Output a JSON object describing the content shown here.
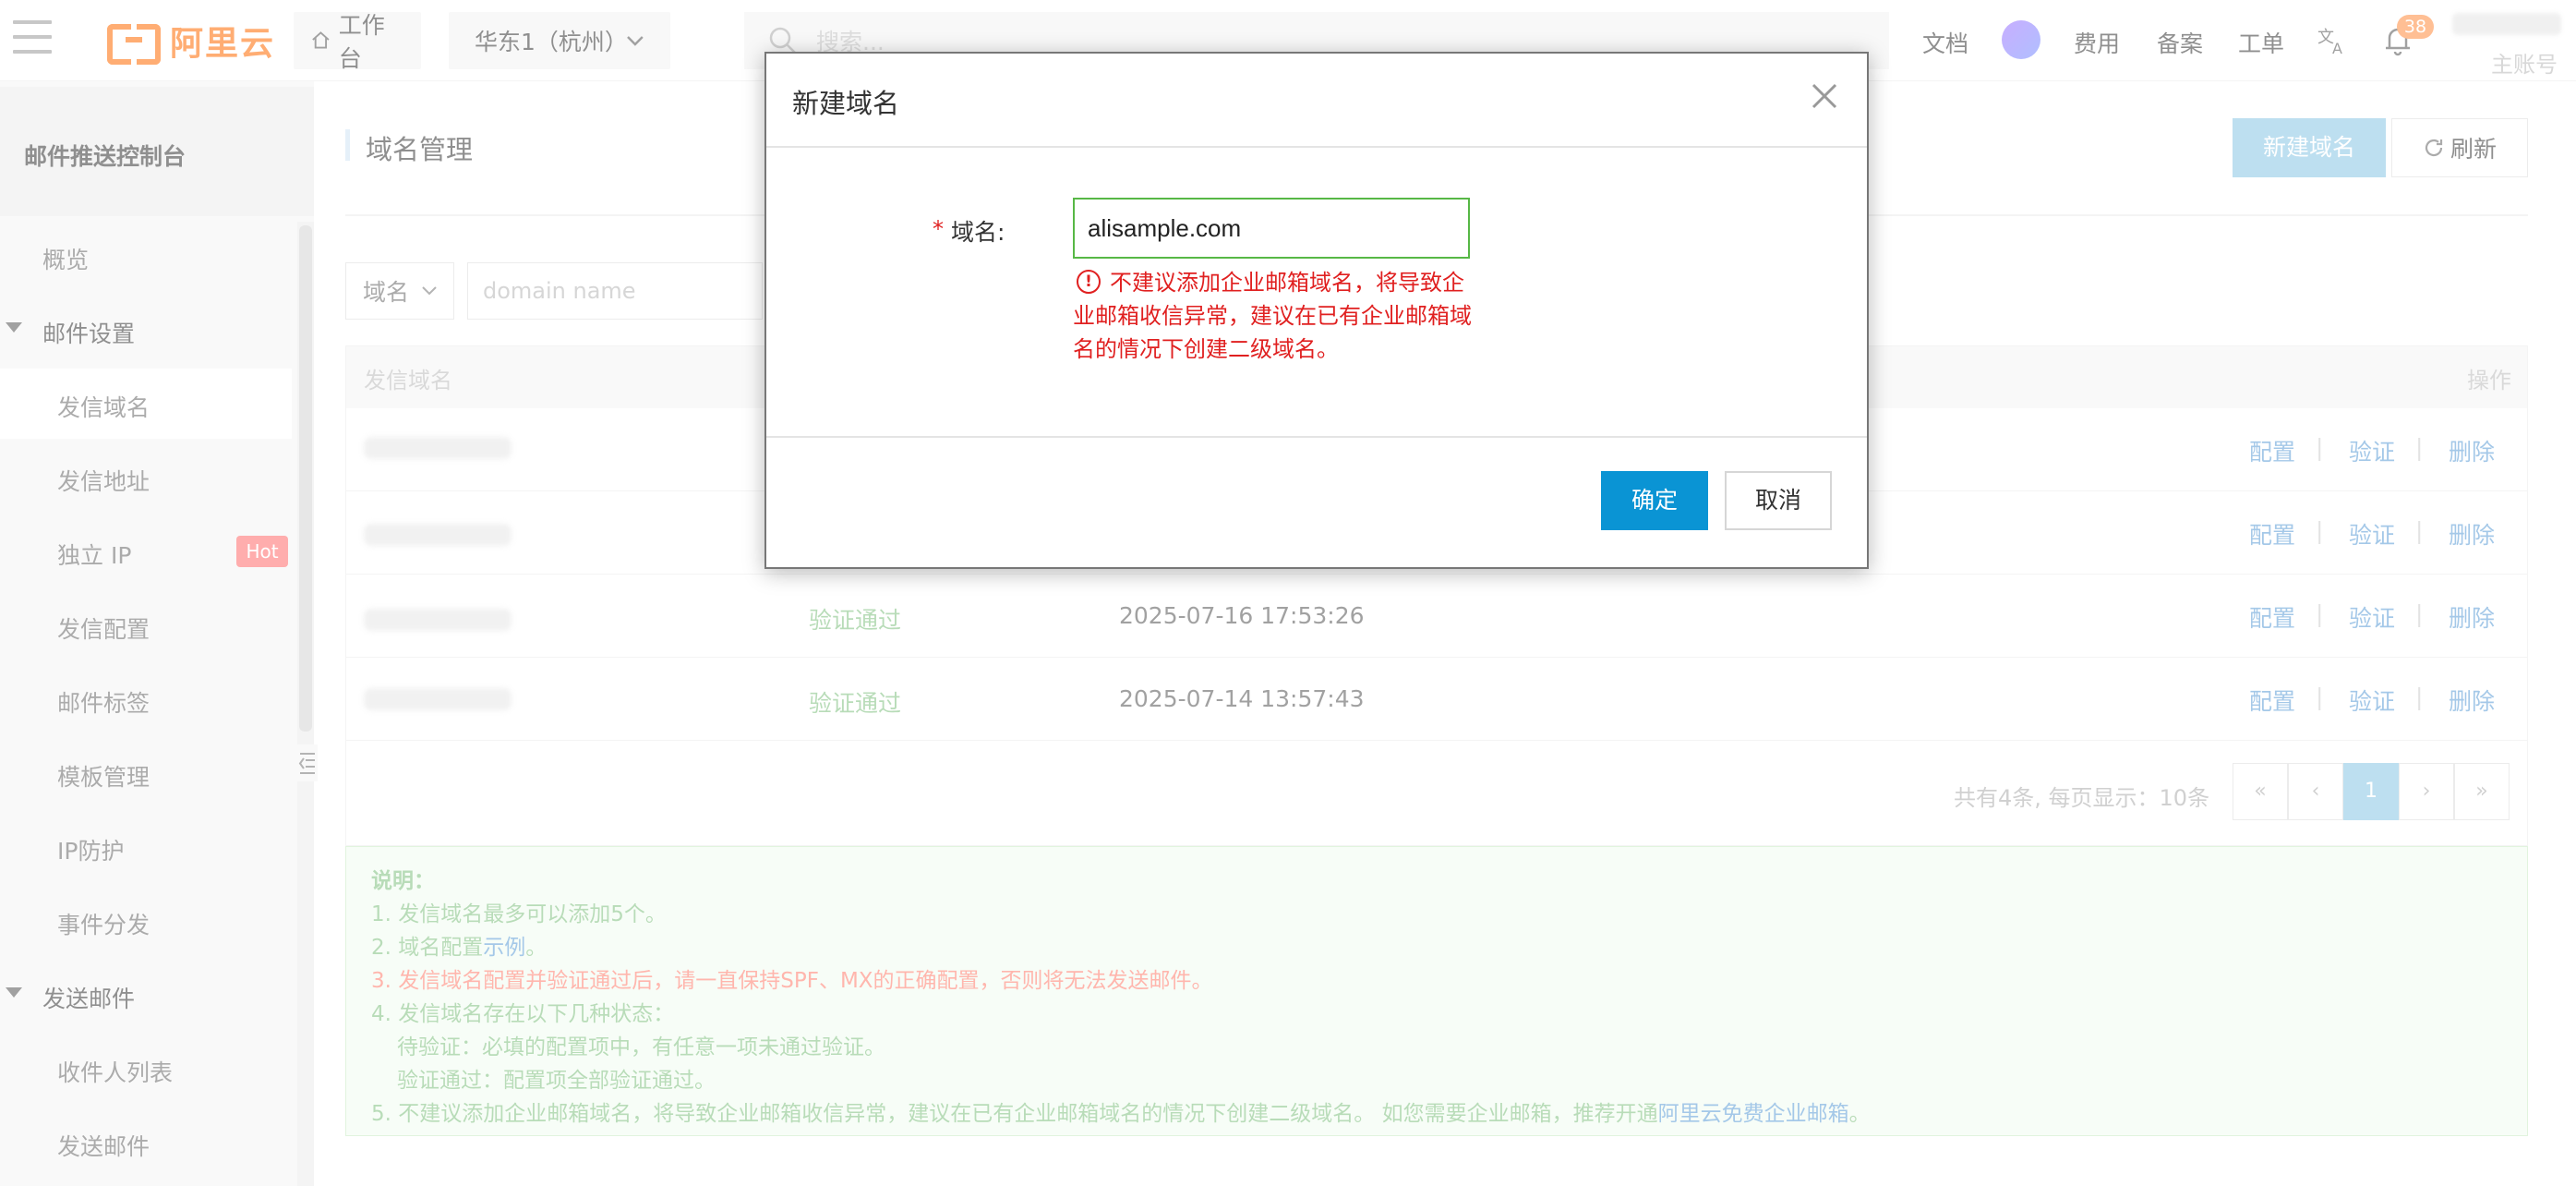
{
  "topbar": {
    "brand": "阿里云",
    "workbench_label": "工作台",
    "region_label": "华东1（杭州）",
    "search_placeholder": "搜索...",
    "links": [
      "文档",
      "费用",
      "备案",
      "工单"
    ],
    "notification_count": "38",
    "account_label": "主账号"
  },
  "sidebar": {
    "title": "邮件推送控制台",
    "items": [
      {
        "label": "概览"
      },
      {
        "label": "邮件设置"
      },
      {
        "label": "发信域名"
      },
      {
        "label": "发信地址"
      },
      {
        "label": "独立 IP",
        "badge": "Hot"
      },
      {
        "label": "发信配置"
      },
      {
        "label": "邮件标签"
      },
      {
        "label": "模板管理"
      },
      {
        "label": "IP防护"
      },
      {
        "label": "事件分发"
      },
      {
        "label": "发送邮件"
      },
      {
        "label": "收件人列表"
      },
      {
        "label": "发送邮件"
      }
    ]
  },
  "main": {
    "title": "域名管理",
    "new_domain_button": "新建域名",
    "refresh_button": "刷新",
    "filter": {
      "select_value": "域名",
      "input_placeholder": "domain name"
    },
    "table": {
      "headers": {
        "domain": "发信域名",
        "actions": "操作"
      },
      "rows": [
        {
          "status": "",
          "time": ""
        },
        {
          "status": "",
          "time": ""
        },
        {
          "status": "验证通过",
          "time": "2025-07-16 17:53:26"
        },
        {
          "status": "验证通过",
          "time": "2025-07-14 13:57:43"
        }
      ],
      "actions": {
        "config": "配置",
        "verify": "验证",
        "delete": "删除",
        "sep": "|"
      }
    },
    "pagination": {
      "summary": "共有4条, 每页显示：10条",
      "first": "«",
      "prev": "‹",
      "current": "1",
      "next": "›",
      "last": "»"
    },
    "notes": {
      "title": "说明：",
      "line1": "1. 发信域名最多可以添加5个。",
      "line2_prefix": "2. 域名配置",
      "line2_link": "示例",
      "line2_suffix": "。",
      "line3": "3. 发信域名配置并验证通过后，请一直保持SPF、MX的正确配置，否则将无法发送邮件。",
      "line4": "4. 发信域名存在以下几种状态：",
      "line4a": "待验证：必填的配置项中，有任意一项未通过验证。",
      "line4b": "验证通过：配置项全部验证通过。",
      "line5_prefix": "5. 不建议添加企业邮箱域名，将导致企业邮箱收信异常，建议在已有企业邮箱域名的情况下创建二级域名。 如您需要企业邮箱，推荐开通",
      "line5_link": "阿里云免费企业邮箱",
      "line5_suffix": "。"
    }
  },
  "modal": {
    "title": "新建域名",
    "required_mark": "*",
    "field_label": "域名:",
    "field_value": "alisample.com",
    "warning_icon": "!",
    "warning": "不建议添加企业邮箱域名，将导致企业邮箱收信异常，建议在已有企业邮箱域名的情况下创建二级域名。",
    "ok_button": "确定",
    "cancel_button": "取消"
  },
  "colors": {
    "brand": "#ff6a00",
    "primary": "#0a94d4",
    "success": "#7fbf7f",
    "error": "#e02020",
    "link": "#5a9bd5"
  }
}
